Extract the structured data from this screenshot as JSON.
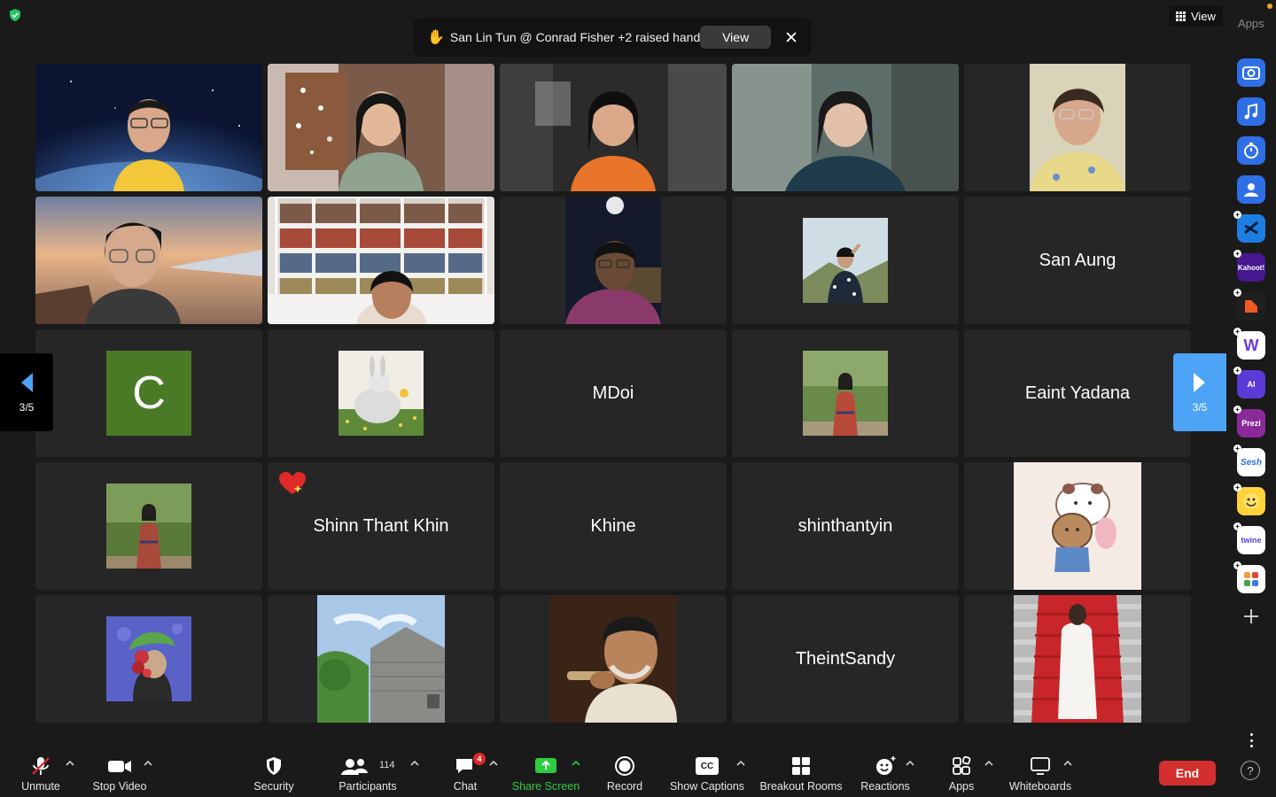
{
  "banner": {
    "hand_emoji": "✋",
    "message": "San Lin Tun @ Conrad Fisher +2 raised hand",
    "view_label": "View"
  },
  "top_view": {
    "label": "View"
  },
  "apps_label": "Apps",
  "page_indicator": {
    "left": "3/5",
    "right": "3/5"
  },
  "tiles": {
    "r2c5": "San Aung",
    "r3c1_avatar": "C",
    "r3c3": "MDoi",
    "r3c5": "Eaint Yadana",
    "r4c2": "Shinn Thant Khin",
    "r4c3": "Khine",
    "r4c4": "shinthantyin",
    "r5c4": "TheintSandy"
  },
  "app_icons": {
    "kahoot": "Kahoot!",
    "prezi": "Prezi",
    "sesh": "Sesh",
    "twine": "twine",
    "ai": "AI"
  },
  "toolbar": {
    "unmute": "Unmute",
    "stop_video": "Stop Video",
    "security": "Security",
    "participants": "Participants",
    "participants_count": "114",
    "chat": "Chat",
    "chat_badge": "4",
    "share_screen": "Share Screen",
    "record": "Record",
    "show_captions": "Show Captions",
    "cc": "CC",
    "breakout_rooms": "Breakout Rooms",
    "reactions": "Reactions",
    "apps": "Apps",
    "whiteboards": "Whiteboards",
    "end": "End"
  },
  "help": "?",
  "colors": {
    "end_red": "#d32f2f",
    "share_green": "#2ecc40",
    "accent_blue": "#4da3f5",
    "security_green": "#23c55e"
  }
}
